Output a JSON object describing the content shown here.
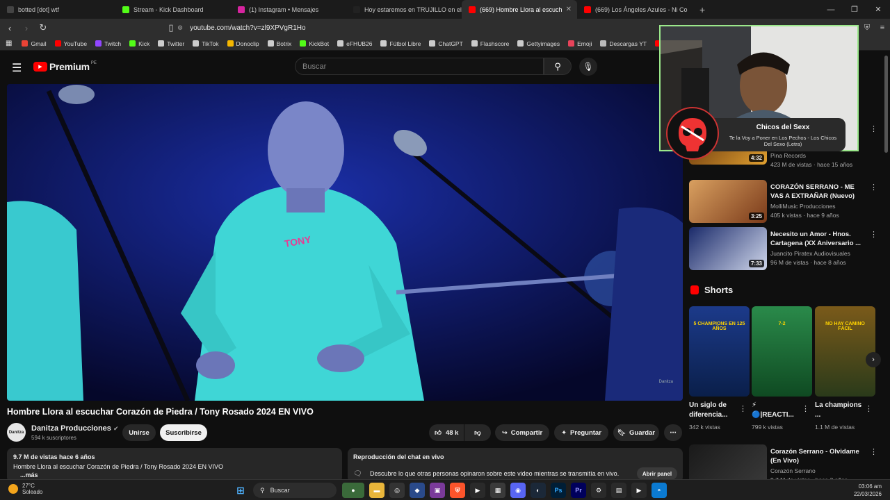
{
  "browser": {
    "tabs": [
      {
        "title": "botted [dot] wtf",
        "favicon": "arrow-icon",
        "color": "#444444"
      },
      {
        "title": "Stream - Kick Dashboard",
        "favicon": "kick-icon",
        "color": "#53fc18"
      },
      {
        "title": "(1) Instagram • Mensajes",
        "favicon": "instagram-icon",
        "color": "#d6249f"
      },
      {
        "title": "Hoy estaremos en TRUJILLO en el ve",
        "favicon": "tiktok-icon",
        "color": "#222222"
      },
      {
        "title": "(669) Hombre Llora al escuch",
        "favicon": "youtube-icon",
        "color": "#ff0000",
        "active": true
      },
      {
        "title": "(669) Los Ángeles Azules - Ni Co",
        "favicon": "youtube-icon",
        "color": "#ff0000"
      }
    ],
    "url": "youtube.com/watch?v=zl9XPVgR1Ho",
    "bookmarks": [
      {
        "label": "Gmail",
        "color": "#ea4335"
      },
      {
        "label": "YouTube",
        "color": "#ff0000"
      },
      {
        "label": "Twitch",
        "color": "#9146ff"
      },
      {
        "label": "Kick",
        "color": "#53fc18"
      },
      {
        "label": "Twitter",
        "color": "#cccccc"
      },
      {
        "label": "TikTok",
        "color": "#cccccc"
      },
      {
        "label": "Donoclip",
        "color": "#f5b700"
      },
      {
        "label": "Botrix",
        "color": "#cccccc"
      },
      {
        "label": "KickBot",
        "color": "#53fc18"
      },
      {
        "label": "eFHUB26",
        "color": "#cccccc"
      },
      {
        "label": "Fútbol Libre",
        "color": "#cccccc"
      },
      {
        "label": "ChatGPT",
        "color": "#cccccc"
      },
      {
        "label": "Flashscore",
        "color": "#cccccc"
      },
      {
        "label": "Gettyimages",
        "color": "#cccccc"
      },
      {
        "label": "Emoji",
        "color": "#e8435a"
      },
      {
        "label": "Descargas YT",
        "color": "#bbbbbb"
      },
      {
        "label": "Mix N",
        "color": "#ff0000"
      }
    ]
  },
  "youtube": {
    "logo_text": "Premium",
    "logo_region": "PE",
    "search_placeholder": "Buscar",
    "video": {
      "title": "Hombre Llora al escuchar Corazón de Piedra / Tony Rosado 2024 EN VIVO",
      "channel": "Danitza Producciones",
      "channel_avatar_text": "Danitza",
      "subscribers": "594 k suscriptores",
      "join": "Unirse",
      "subscribe": "Suscribirse",
      "likes": "48 k",
      "share": "Compartir",
      "ask": "Preguntar",
      "save": "Guardar",
      "watermark": "Danitza",
      "views_date": "9.7 M de vistas  hace 6 años",
      "description": "Hombre Llora al escuchar Corazón de Piedra / Tony Rosado 2024 EN VIVO",
      "more": "...más"
    },
    "chat_replay": {
      "title": "Reproducción del chat en vivo",
      "text": "Descubre lo que otras personas opinaron sobre este video mientras se transmitía en vivo.",
      "button": "Abrir panel"
    },
    "related": [
      {
        "title": "",
        "channel": "Pina Records",
        "stats": "423 M de vistas · hace 15 años",
        "duration": "4:32",
        "c1": "#5a2a0a",
        "c2": "#e0a030"
      },
      {
        "title": "CORAZÓN SERRANO - ME VAS A EXTRAÑAR (Nuevo)",
        "channel": "MolliMusic Producciones",
        "stats": "405 k vistas · hace 9 años",
        "duration": "3:25",
        "c1": "#d9a060",
        "c2": "#7a3a1a"
      },
      {
        "title": "Necesito un Amor - Hnos. Cartagena (XX Aniversario ...",
        "channel": "Juancito Piratex Audiovisuales",
        "stats": "96 M de vistas · hace 8 años",
        "duration": "7:33",
        "c1": "#1a2a6a",
        "c2": "#cfd6ea"
      },
      {
        "title": "Corazón Serrano - Olvidame (En Vivo)",
        "channel": "Corazón Serrano",
        "stats": "9.7 M de vistas · hace 3 años",
        "duration": "",
        "c1": "#1a1a1a",
        "c2": "#3a3a3a"
      }
    ],
    "shorts_title": "Shorts",
    "shorts": [
      {
        "title": "Un siglo de diferencia...",
        "views": "342 k vistas",
        "caption": "5 CHAMPIONS EN 125 AÑOS",
        "c1": "#1c3a8a",
        "c2": "#0a1f4a"
      },
      {
        "title": "⚡ 🔵|REACTI...",
        "views": "799 k vistas",
        "caption": "7-2",
        "c1": "#2a8a4a",
        "c2": "#0f4a22"
      },
      {
        "title": "La champions ...",
        "views": "1.1 M de vistas",
        "caption": "NO HAY CAMINO FÁCIL",
        "c1": "#7a5a1a",
        "c2": "#2a3a1a"
      }
    ]
  },
  "overlay": {
    "artist": "Chicos del Sexx",
    "song": "Te la Voy a Poner en Los Pechos - Los Chicos Del Sexo (Letra)"
  },
  "taskbar": {
    "temperature": "27°C",
    "condition": "Soleado",
    "search": "Buscar",
    "time": "03:06 am",
    "date": "22/03/2026"
  }
}
